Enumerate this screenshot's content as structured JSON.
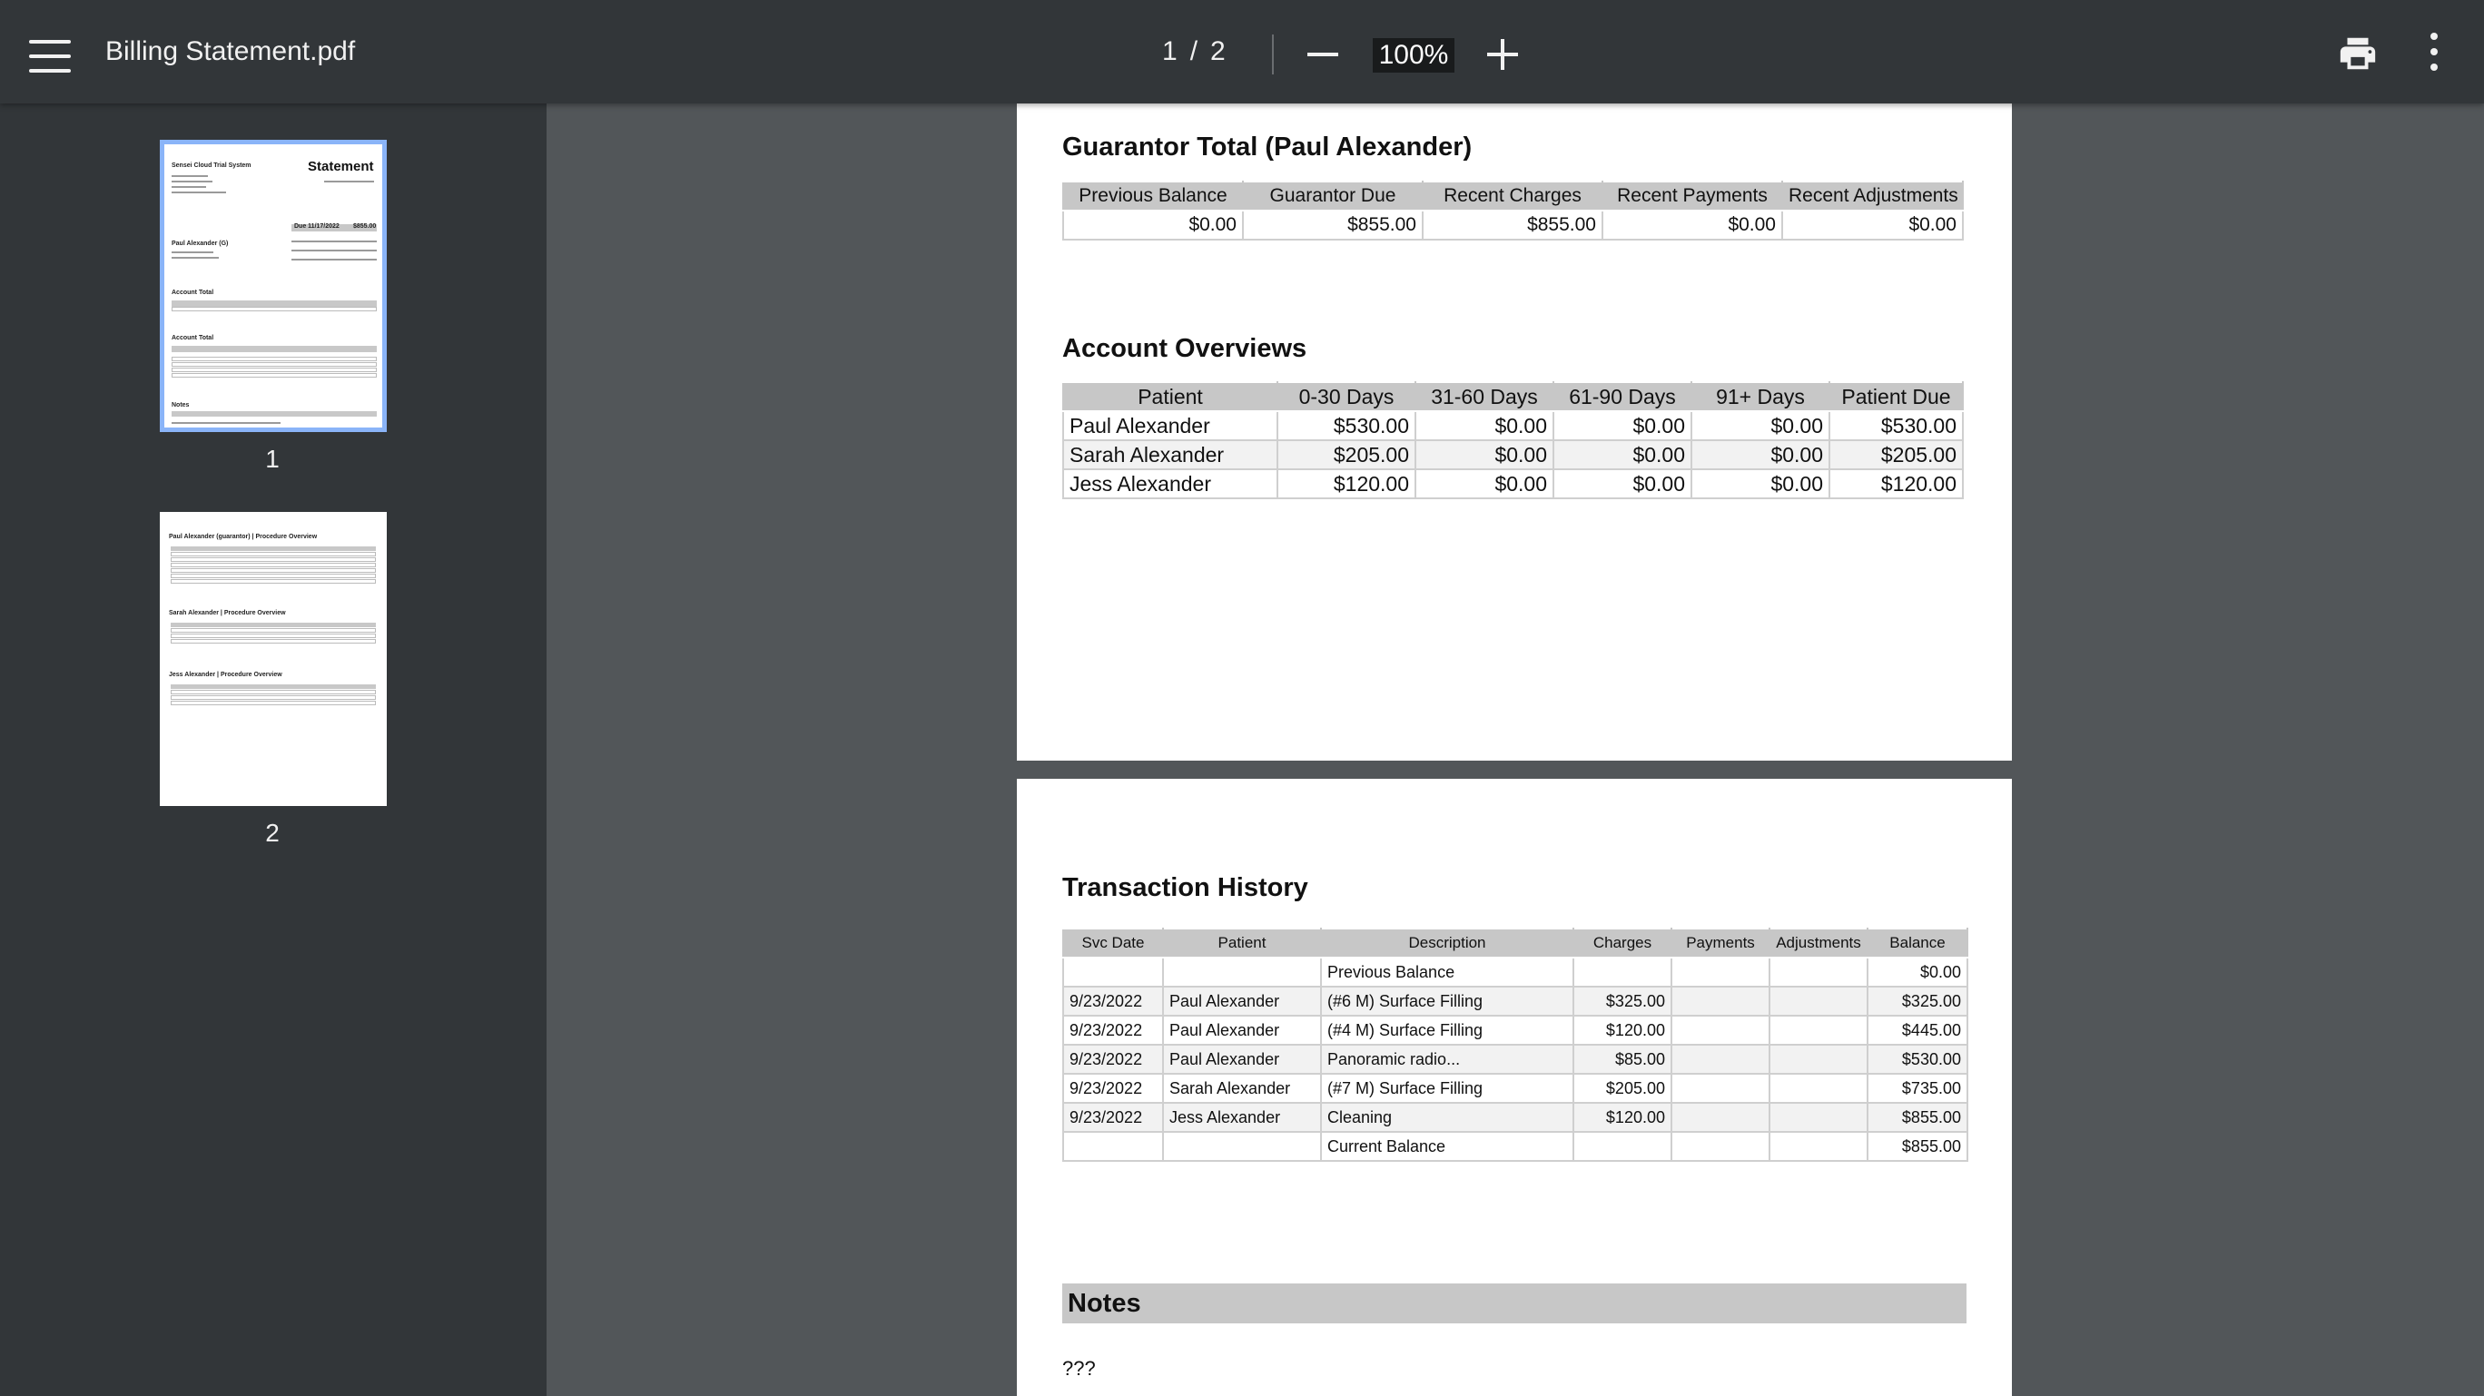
{
  "toolbar": {
    "title": "Billing Statement.pdf",
    "current_page": "1",
    "page_separator": "/",
    "total_pages": "2",
    "zoom": "100%"
  },
  "sidebar": {
    "thumbnails": [
      {
        "label": "1",
        "selected": true,
        "mini": {
          "heading": "Statement",
          "org": "Sensei Cloud Trial System",
          "due": "Due 11/17/2022",
          "due_amount": "$855.00",
          "guarantor": "Paul Alexander (G)",
          "section1": "Account Total",
          "section2": "Account Total",
          "notes": "Notes"
        }
      },
      {
        "label": "2",
        "selected": false,
        "mini": {
          "s1": "Paul Alexander (guarantor) | Procedure Overview",
          "s2": "Sarah Alexander | Procedure Overview",
          "s3": "Jess Alexander | Procedure Overview"
        }
      }
    ]
  },
  "page1": {
    "guarantor_total": {
      "title": "Guarantor Total (Paul Alexander)",
      "headers": [
        "Previous Balance",
        "Guarantor Due",
        "Recent Charges",
        "Recent Payments",
        "Recent Adjustments"
      ],
      "row": [
        "$0.00",
        "$855.00",
        "$855.00",
        "$0.00",
        "$0.00"
      ]
    },
    "account_overviews": {
      "title": "Account Overviews",
      "headers": [
        "Patient",
        "0-30 Days",
        "31-60 Days",
        "61-90 Days",
        "91+ Days",
        "Patient Due"
      ],
      "rows": [
        [
          "Paul Alexander",
          "$530.00",
          "$0.00",
          "$0.00",
          "$0.00",
          "$530.00"
        ],
        [
          "Sarah Alexander",
          "$205.00",
          "$0.00",
          "$0.00",
          "$0.00",
          "$205.00"
        ],
        [
          "Jess Alexander",
          "$120.00",
          "$0.00",
          "$0.00",
          "$0.00",
          "$120.00"
        ]
      ]
    }
  },
  "page2": {
    "transaction_history": {
      "title": "Transaction History",
      "headers": [
        "Svc Date",
        "Patient",
        "Description",
        "Charges",
        "Payments",
        "Adjustments",
        "Balance"
      ],
      "rows": [
        [
          "",
          "",
          "Previous Balance",
          "",
          "",
          "",
          "$0.00"
        ],
        [
          "9/23/2022",
          "Paul Alexander",
          "(#6 M) Surface Filling",
          "$325.00",
          "",
          "",
          "$325.00"
        ],
        [
          "9/23/2022",
          "Paul Alexander",
          "(#4 M) Surface Filling",
          "$120.00",
          "",
          "",
          "$445.00"
        ],
        [
          "9/23/2022",
          "Paul Alexander",
          "Panoramic radio...",
          "$85.00",
          "",
          "",
          "$530.00"
        ],
        [
          "9/23/2022",
          "Sarah Alexander",
          "(#7 M) Surface Filling",
          "$205.00",
          "",
          "",
          "$735.00"
        ],
        [
          "9/23/2022",
          "Jess Alexander",
          "Cleaning",
          "$120.00",
          "",
          "",
          "$855.00"
        ],
        [
          "",
          "",
          "Current Balance",
          "",
          "",
          "",
          "$855.00"
        ]
      ]
    },
    "notes": {
      "title": "Notes",
      "text": "???"
    }
  },
  "icons": {
    "menu": "hamburger-icon",
    "zoom_out": "minus-icon",
    "zoom_in": "plus-icon",
    "print": "printer-icon",
    "more": "kebab-icon"
  },
  "colors": {
    "toolbar_bg": "#323639",
    "viewer_bg": "#525659",
    "thumb_selected_border": "#8ab4f8",
    "table_header_bg": "#c7c7c7"
  }
}
